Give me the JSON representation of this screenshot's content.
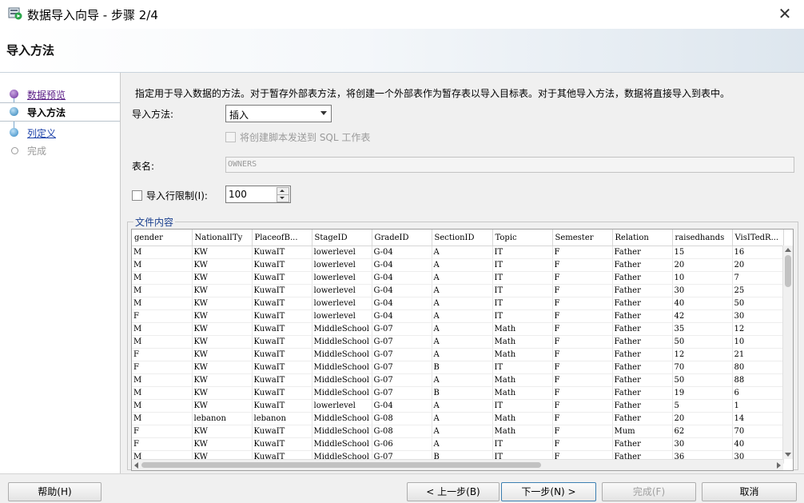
{
  "window": {
    "title": "数据导入向导 - 步骤 2/4"
  },
  "header": {
    "title": "导入方法"
  },
  "steps": [
    {
      "label": "数据预览",
      "state": "visited"
    },
    {
      "label": "导入方法",
      "state": "current"
    },
    {
      "label": "列定义",
      "state": "next"
    },
    {
      "label": "完成",
      "state": "future"
    }
  ],
  "main": {
    "description": "指定用于导入数据的方法。对于暂存外部表方法，将创建一个外部表作为暂存表以导入目标表。对于其他导入方法，数据将直接导入到表中。",
    "method_label": "导入方法:",
    "method_value": "插入",
    "script_checkbox_label": "将创建脚本发送到 SQL 工作表",
    "table_label": "表名:",
    "table_value": "OWNERS",
    "limit_label": "导入行限制(I):",
    "limit_value": "100",
    "file_content_label": "文件内容"
  },
  "grid": {
    "columns": [
      "gender",
      "NationalITy",
      "PlaceofB...",
      "StageID",
      "GradeID",
      "SectionID",
      "Topic",
      "Semester",
      "Relation",
      "raisedhands",
      "VisITedR..."
    ],
    "rows": [
      [
        "M",
        "KW",
        "KuwaIT",
        "lowerlevel",
        "G-04",
        "A",
        "IT",
        "F",
        "Father",
        "15",
        "16"
      ],
      [
        "M",
        "KW",
        "KuwaIT",
        "lowerlevel",
        "G-04",
        "A",
        "IT",
        "F",
        "Father",
        "20",
        "20"
      ],
      [
        "M",
        "KW",
        "KuwaIT",
        "lowerlevel",
        "G-04",
        "A",
        "IT",
        "F",
        "Father",
        "10",
        "7"
      ],
      [
        "M",
        "KW",
        "KuwaIT",
        "lowerlevel",
        "G-04",
        "A",
        "IT",
        "F",
        "Father",
        "30",
        "25"
      ],
      [
        "M",
        "KW",
        "KuwaIT",
        "lowerlevel",
        "G-04",
        "A",
        "IT",
        "F",
        "Father",
        "40",
        "50"
      ],
      [
        "F",
        "KW",
        "KuwaIT",
        "lowerlevel",
        "G-04",
        "A",
        "IT",
        "F",
        "Father",
        "42",
        "30"
      ],
      [
        "M",
        "KW",
        "KuwaIT",
        "MiddleSchool",
        "G-07",
        "A",
        "Math",
        "F",
        "Father",
        "35",
        "12"
      ],
      [
        "M",
        "KW",
        "KuwaIT",
        "MiddleSchool",
        "G-07",
        "A",
        "Math",
        "F",
        "Father",
        "50",
        "10"
      ],
      [
        "F",
        "KW",
        "KuwaIT",
        "MiddleSchool",
        "G-07",
        "A",
        "Math",
        "F",
        "Father",
        "12",
        "21"
      ],
      [
        "F",
        "KW",
        "KuwaIT",
        "MiddleSchool",
        "G-07",
        "B",
        "IT",
        "F",
        "Father",
        "70",
        "80"
      ],
      [
        "M",
        "KW",
        "KuwaIT",
        "MiddleSchool",
        "G-07",
        "A",
        "Math",
        "F",
        "Father",
        "50",
        "88"
      ],
      [
        "M",
        "KW",
        "KuwaIT",
        "MiddleSchool",
        "G-07",
        "B",
        "Math",
        "F",
        "Father",
        "19",
        "6"
      ],
      [
        "M",
        "KW",
        "KuwaIT",
        "lowerlevel",
        "G-04",
        "A",
        "IT",
        "F",
        "Father",
        "5",
        "1"
      ],
      [
        "M",
        "lebanon",
        "lebanon",
        "MiddleSchool",
        "G-08",
        "A",
        "Math",
        "F",
        "Father",
        "20",
        "14"
      ],
      [
        "F",
        "KW",
        "KuwaIT",
        "MiddleSchool",
        "G-08",
        "A",
        "Math",
        "F",
        "Mum",
        "62",
        "70"
      ],
      [
        "F",
        "KW",
        "KuwaIT",
        "MiddleSchool",
        "G-06",
        "A",
        "IT",
        "F",
        "Father",
        "30",
        "40"
      ],
      [
        "M",
        "KW",
        "KuwaIT",
        "MiddleSchool",
        "G-07",
        "B",
        "IT",
        "F",
        "Father",
        "36",
        "30"
      ]
    ]
  },
  "footer": {
    "help": "帮助(H)",
    "back": "< 上一步(B)",
    "next": "下一步(N) >",
    "finish": "完成(F)",
    "cancel": "取消"
  }
}
